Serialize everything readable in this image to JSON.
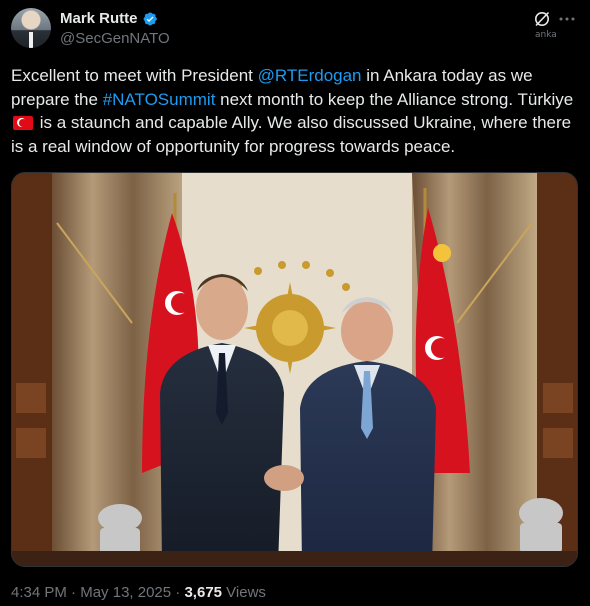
{
  "author": {
    "display_name": "Mark Rutte",
    "handle": "@SecGenNATO",
    "verified": true,
    "verified_color": "#1d9bf0"
  },
  "header_actions": {
    "grok_icon": "grok-slash-circle-icon",
    "more_icon": "more-horizontal-icon",
    "watermark": "anka"
  },
  "tweet": {
    "line1_a": "Excellent to meet with President ",
    "mention": "@RTErdogan",
    "line1_b": " in Ankara today as we prepare the ",
    "hashtag": "#NATOSummit",
    "line1_c": " next month to keep the Alliance strong. Türkiye ",
    "flag": "turkey-flag-icon",
    "line1_d": " is a staunch and capable Ally. We also discussed Ukraine, where there is a real window of opportunity for progress towards peace."
  },
  "media": {
    "type": "photo",
    "description_icon": "photo-two-leaders-handshake"
  },
  "meta": {
    "time": "4:34 PM",
    "sep1": " · ",
    "date": "May 13, 2025",
    "sep2": " · ",
    "views_count": "3,675",
    "views_label": " Views"
  },
  "colors": {
    "background": "#000000",
    "text": "#e7e9ea",
    "secondary": "#71767b",
    "link": "#1d9bf0"
  }
}
